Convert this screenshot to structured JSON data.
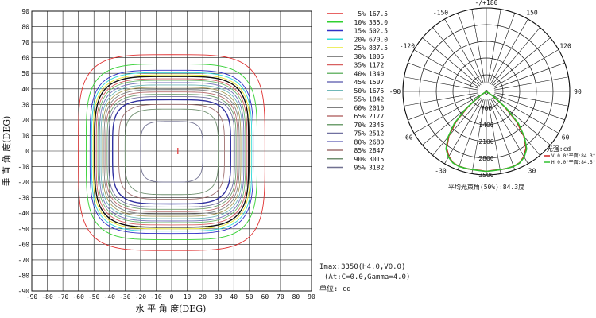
{
  "chart_data": [
    {
      "type": "contour",
      "xlabel": "水 平 角 度(DEG)",
      "ylabel": "垂 直 角 度(DEG)",
      "xlim": [
        -90,
        90
      ],
      "ylim": [
        -90,
        90
      ],
      "x_ticks": [
        -90,
        -80,
        -70,
        -60,
        -50,
        -40,
        -30,
        -20,
        -10,
        0,
        10,
        20,
        30,
        40,
        50,
        60,
        70,
        80,
        90
      ],
      "y_ticks": [
        90,
        80,
        70,
        60,
        50,
        40,
        30,
        20,
        10,
        0,
        -10,
        -20,
        -30,
        -40,
        -50,
        -60,
        -70,
        -80,
        -90
      ],
      "grid": true,
      "legend_position": "right",
      "levels": [
        {
          "pct": "5%",
          "cd": "167.5",
          "color": "#e03030",
          "hr": 60,
          "vt": 62,
          "vb": 64
        },
        {
          "pct": "10%",
          "cd": "335.0",
          "color": "#30d030",
          "hr": 55,
          "vt": 56,
          "vb": 57
        },
        {
          "pct": "15%",
          "cd": "502.5",
          "color": "#3030c8",
          "hr": 52.5,
          "vt": 52,
          "vb": 53
        },
        {
          "pct": "20%",
          "cd": "670.0",
          "color": "#30d8d8",
          "hr": 51.5,
          "vt": 50.5,
          "vb": 51.5
        },
        {
          "pct": "25%",
          "cd": "837.5",
          "color": "#e8e830",
          "hr": 50.5,
          "vt": 49,
          "vb": 50
        },
        {
          "pct": "30%",
          "cd": "1005",
          "color": "#101010",
          "hr": 49.5,
          "vt": 48,
          "vb": 49
        },
        {
          "pct": "35%",
          "cd": "1172",
          "color": "#d86060",
          "hr": 48.5,
          "vt": 46.5,
          "vb": 47.5
        },
        {
          "pct": "40%",
          "cd": "1340",
          "color": "#70b870",
          "hr": 47.5,
          "vt": 45.5,
          "vb": 46
        },
        {
          "pct": "45%",
          "cd": "1507",
          "color": "#7070b8",
          "hr": 46.5,
          "vt": 44,
          "vb": 45
        },
        {
          "pct": "50%",
          "cd": "1675",
          "color": "#70b8b8",
          "hr": 45.5,
          "vt": 42.5,
          "vb": 43.5
        },
        {
          "pct": "55%",
          "cd": "1842",
          "color": "#a89e5c",
          "hr": 44.5,
          "vt": 41,
          "vb": 42
        },
        {
          "pct": "60%",
          "cd": "2010",
          "color": "#808080",
          "hr": 43.5,
          "vt": 39.5,
          "vb": 40.5
        },
        {
          "pct": "65%",
          "cd": "2177",
          "color": "#b87070",
          "hr": 42.5,
          "vt": 38,
          "vb": 39
        },
        {
          "pct": "70%",
          "cd": "2345",
          "color": "#70a070",
          "hr": 41.5,
          "vt": 36.5,
          "vb": 37.5
        },
        {
          "pct": "75%",
          "cd": "2512",
          "color": "#7070a0",
          "hr": 40.5,
          "vt": 35,
          "vb": 36
        },
        {
          "pct": "80%",
          "cd": "2680",
          "color": "#3030a0",
          "hr": 38,
          "vt": 33,
          "vb": 34
        },
        {
          "pct": "85%",
          "cd": "2847",
          "color": "#a07070",
          "hr": 34,
          "vt": 30,
          "vb": 31
        },
        {
          "pct": "90%",
          "cd": "3015",
          "color": "#709070",
          "hr": 30,
          "vt": 27,
          "vb": 28
        },
        {
          "pct": "95%",
          "cd": "3182",
          "color": "#707090",
          "hr": 20,
          "vt": 19,
          "vb": 20
        }
      ],
      "peak_marker": {
        "h": 4.0,
        "v": 0.0,
        "color": "#e03030"
      }
    },
    {
      "type": "polar",
      "top_label": "-/+180",
      "angle_labels": [
        {
          "text": "-150",
          "deg": -150
        },
        {
          "text": "150",
          "deg": 150
        },
        {
          "text": "-120",
          "deg": -120
        },
        {
          "text": "120",
          "deg": 120
        },
        {
          "text": "-90",
          "deg": -90
        },
        {
          "text": "90",
          "deg": 90
        },
        {
          "text": "-60",
          "deg": -60
        },
        {
          "text": "60",
          "deg": 60
        },
        {
          "text": "-30",
          "deg": -30
        },
        {
          "text": "30",
          "deg": 30
        },
        {
          "text": "0",
          "deg": 0
        }
      ],
      "r_max": 3500,
      "r_rings": [
        700,
        1400,
        2100,
        2800,
        3500
      ],
      "r_labels": [
        "700",
        "1400",
        "2100",
        "2800",
        "3500"
      ],
      "spoke_step_deg": 10,
      "series": [
        {
          "name": "V 0.0°平面:84.3°",
          "color": "#cc2020",
          "angles": [
            -60,
            -55,
            -50,
            -45,
            -40,
            -35,
            -30,
            -25,
            -20,
            -15,
            -10,
            -5,
            0,
            5,
            10,
            15,
            20,
            25,
            30,
            35,
            40,
            45,
            50,
            55,
            60
          ],
          "values": [
            0,
            350,
            1000,
            1800,
            2450,
            2900,
            3150,
            3300,
            3340,
            3340,
            3330,
            3320,
            3350,
            3320,
            3330,
            3340,
            3340,
            3300,
            3150,
            2900,
            2450,
            1800,
            1000,
            350,
            0
          ]
        },
        {
          "name": "H 0.0°平面:84.5°",
          "color": "#30c030",
          "angles": [
            -60,
            -55,
            -50,
            -45,
            -40,
            -35,
            -30,
            -25,
            -20,
            -15,
            -10,
            -5,
            0,
            5,
            10,
            15,
            20,
            25,
            30,
            35,
            40,
            45,
            50,
            55,
            60
          ],
          "values": [
            0,
            400,
            1100,
            1900,
            2500,
            2950,
            3180,
            3310,
            3350,
            3340,
            3330,
            3330,
            3350,
            3330,
            3330,
            3340,
            3350,
            3310,
            3180,
            2950,
            2500,
            1900,
            1100,
            400,
            0
          ]
        }
      ],
      "legend_title": "光强:cd",
      "beam_angle_caption": "平均光束角(50%):84.3度"
    }
  ],
  "info": {
    "imax": "Imax:3350(H4.0,V0.0)",
    "params": "(At:C=0.0,Gamma=4.0)",
    "unit": "单位: cd"
  }
}
